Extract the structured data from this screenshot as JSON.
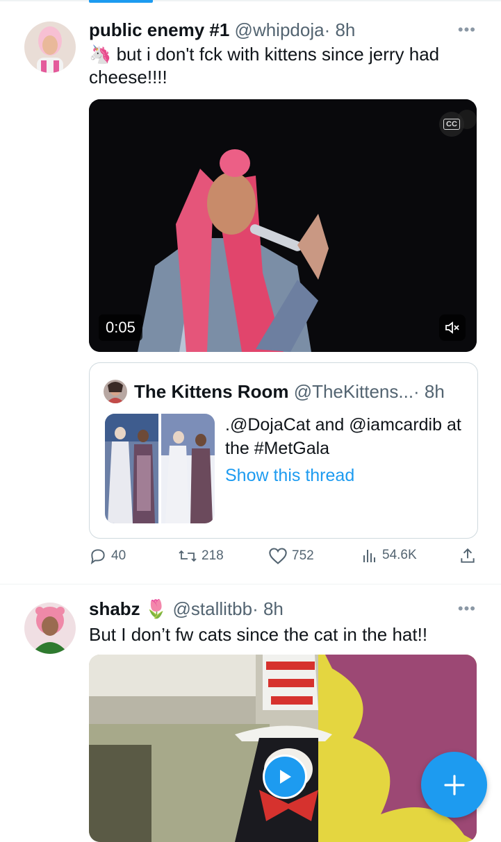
{
  "tweets": [
    {
      "name": "public enemy #1",
      "handle": "@whipdoja",
      "time": "· 8h",
      "text_emoji": "🦄",
      "text": " but i don't fck with kittens since jerry had cheese!!!!",
      "media": {
        "type": "video",
        "duration": "0:05",
        "cc": "CC"
      },
      "quote": {
        "name": "The Kittens Room",
        "handle": "@TheKittens...",
        "time": "· 8h",
        "text": ".@DojaCat and @iamcardib at the #MetGala",
        "link": "Show this thread"
      },
      "actions": {
        "replies": "40",
        "retweets": "218",
        "likes": "752",
        "views": "54.6K"
      }
    },
    {
      "name": "shabz",
      "name_emoji": "🌷",
      "handle": "@stallitbb",
      "time": "· 8h",
      "text": "But I don’t fw cats since the cat in the hat!!",
      "media": {
        "type": "video"
      }
    }
  ],
  "colors": {
    "accent": "#1d9bf0",
    "text": "#0f1419",
    "muted": "#536471",
    "border": "#cfd9de"
  }
}
